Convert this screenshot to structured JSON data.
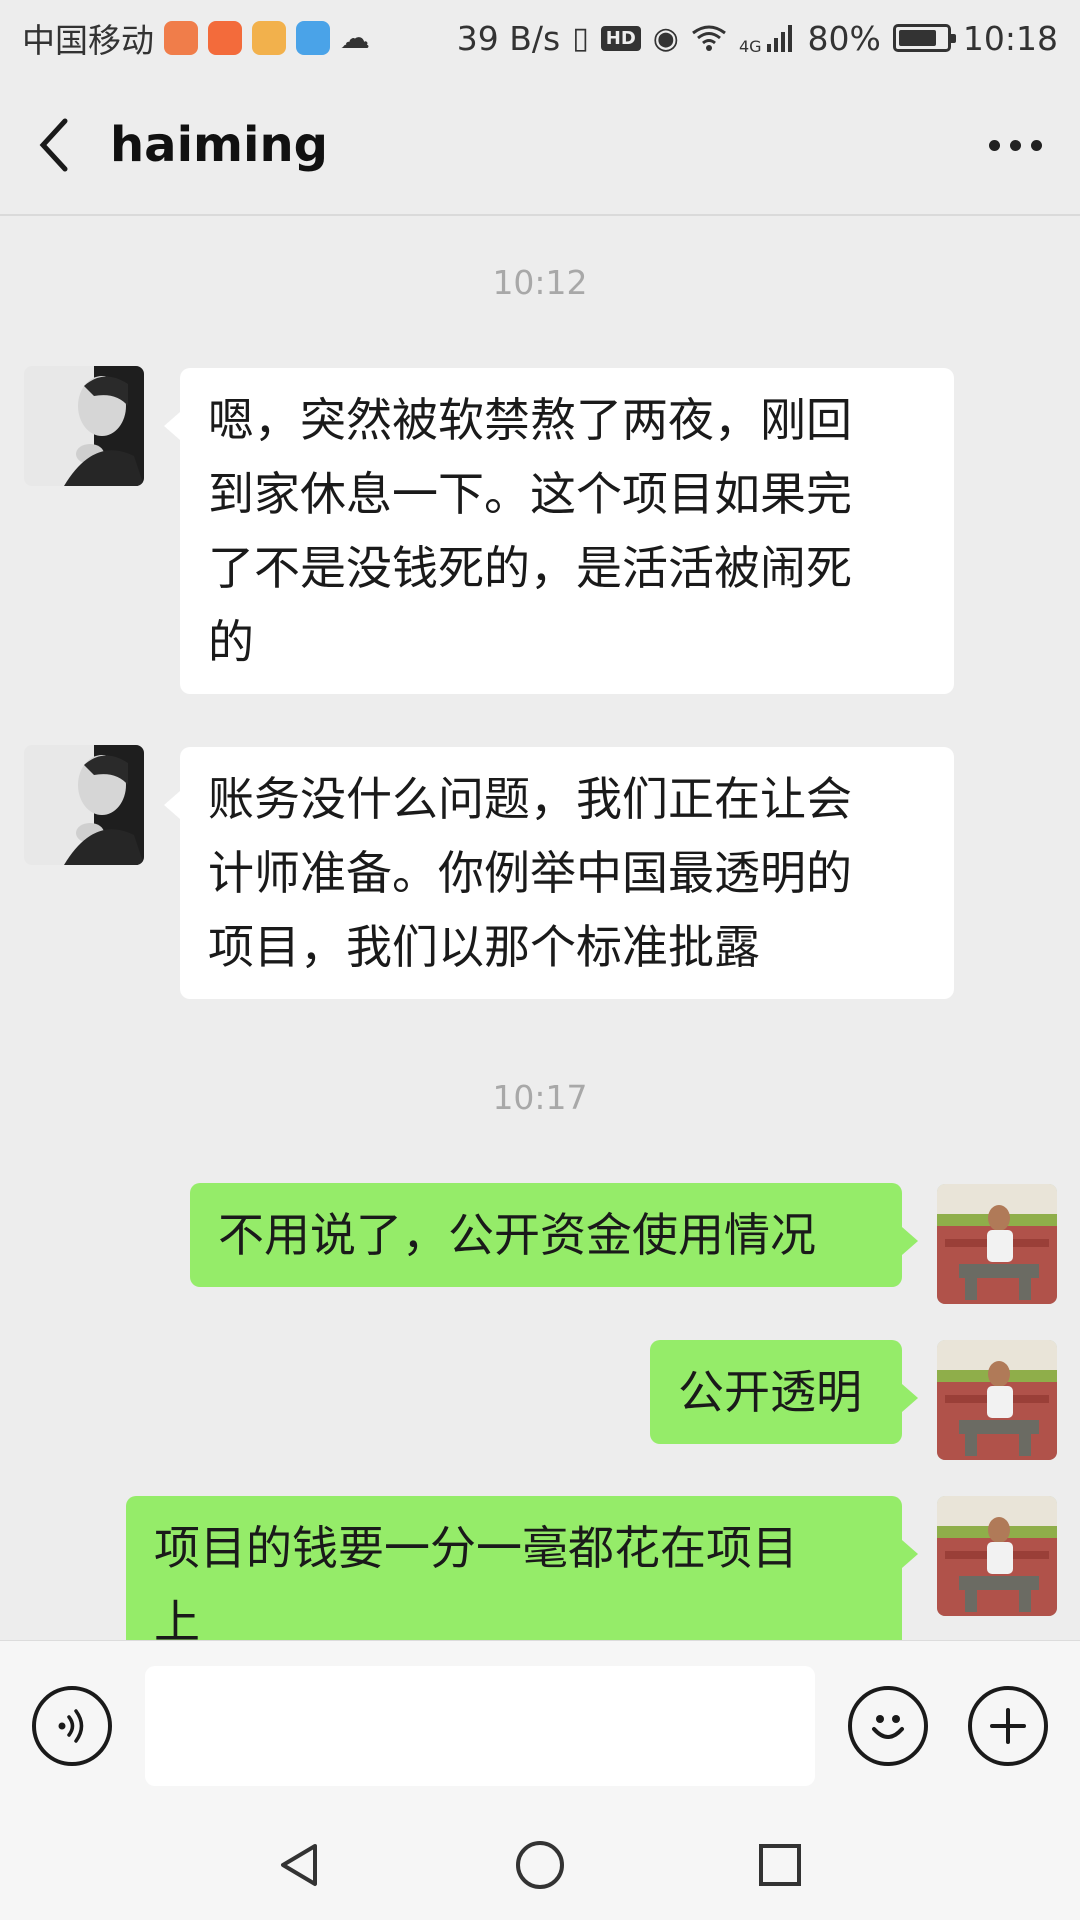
{
  "status_bar": {
    "carrier": "中国移动",
    "net_speed": "39 B/s",
    "hd": "HD",
    "network": "4G",
    "battery": "80%",
    "battery_level": 0.8,
    "time": "10:18"
  },
  "header": {
    "title": "haiming"
  },
  "messages": [
    {
      "type": "time",
      "text": "10:12"
    },
    {
      "type": "incoming",
      "sender": "haiming",
      "lines": [
        "嗯，突然被软禁熬了两夜，刚回",
        "到家休息一下。这个项目如果完",
        "了不是没钱死的，是活活被闹死",
        "的"
      ]
    },
    {
      "type": "incoming",
      "sender": "haiming",
      "lines": [
        "账务没什么问题，我们正在让会",
        "计师准备。你例举中国最透明的",
        "项目，我们以那个标准批露"
      ]
    },
    {
      "type": "time",
      "text": "10:17"
    },
    {
      "type": "outgoing",
      "lines": [
        "不用说了，公开资金使用情况"
      ]
    },
    {
      "type": "outgoing",
      "lines": [
        "公开透明"
      ]
    },
    {
      "type": "outgoing",
      "lines": [
        "项目的钱要一分一毫都花在项目",
        "上"
      ]
    }
  ],
  "input": {
    "value": "",
    "voice_icon": "voice-icon",
    "emoji_icon": "emoji-icon",
    "plus_icon": "plus-icon"
  },
  "colors": {
    "background": "#ededed",
    "incoming_bubble": "#ffffff",
    "outgoing_bubble": "#95ec69",
    "timestamp": "#a8a8a8"
  }
}
